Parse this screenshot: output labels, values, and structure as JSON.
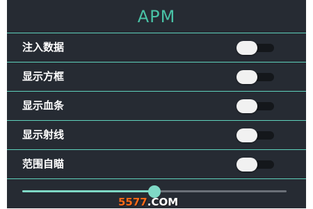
{
  "app": {
    "title": "APM"
  },
  "settings": [
    {
      "label": "注入数据",
      "enabled": false
    },
    {
      "label": "显示方框",
      "enabled": false
    },
    {
      "label": "显示血条",
      "enabled": false
    },
    {
      "label": "显示射线",
      "enabled": false
    },
    {
      "label": "范围自瞄",
      "enabled": false
    }
  ],
  "slider": {
    "value_fraction": 0.5
  },
  "watermark": {
    "number": "5577",
    "domain": ".COM"
  },
  "colors": {
    "background": "#262b33",
    "accent": "#49c2a6",
    "divider": "#5fd3bd",
    "slider_active": "#7fd9c6",
    "switch_thumb": "#f1f1f1",
    "switch_track": "#14171b"
  }
}
